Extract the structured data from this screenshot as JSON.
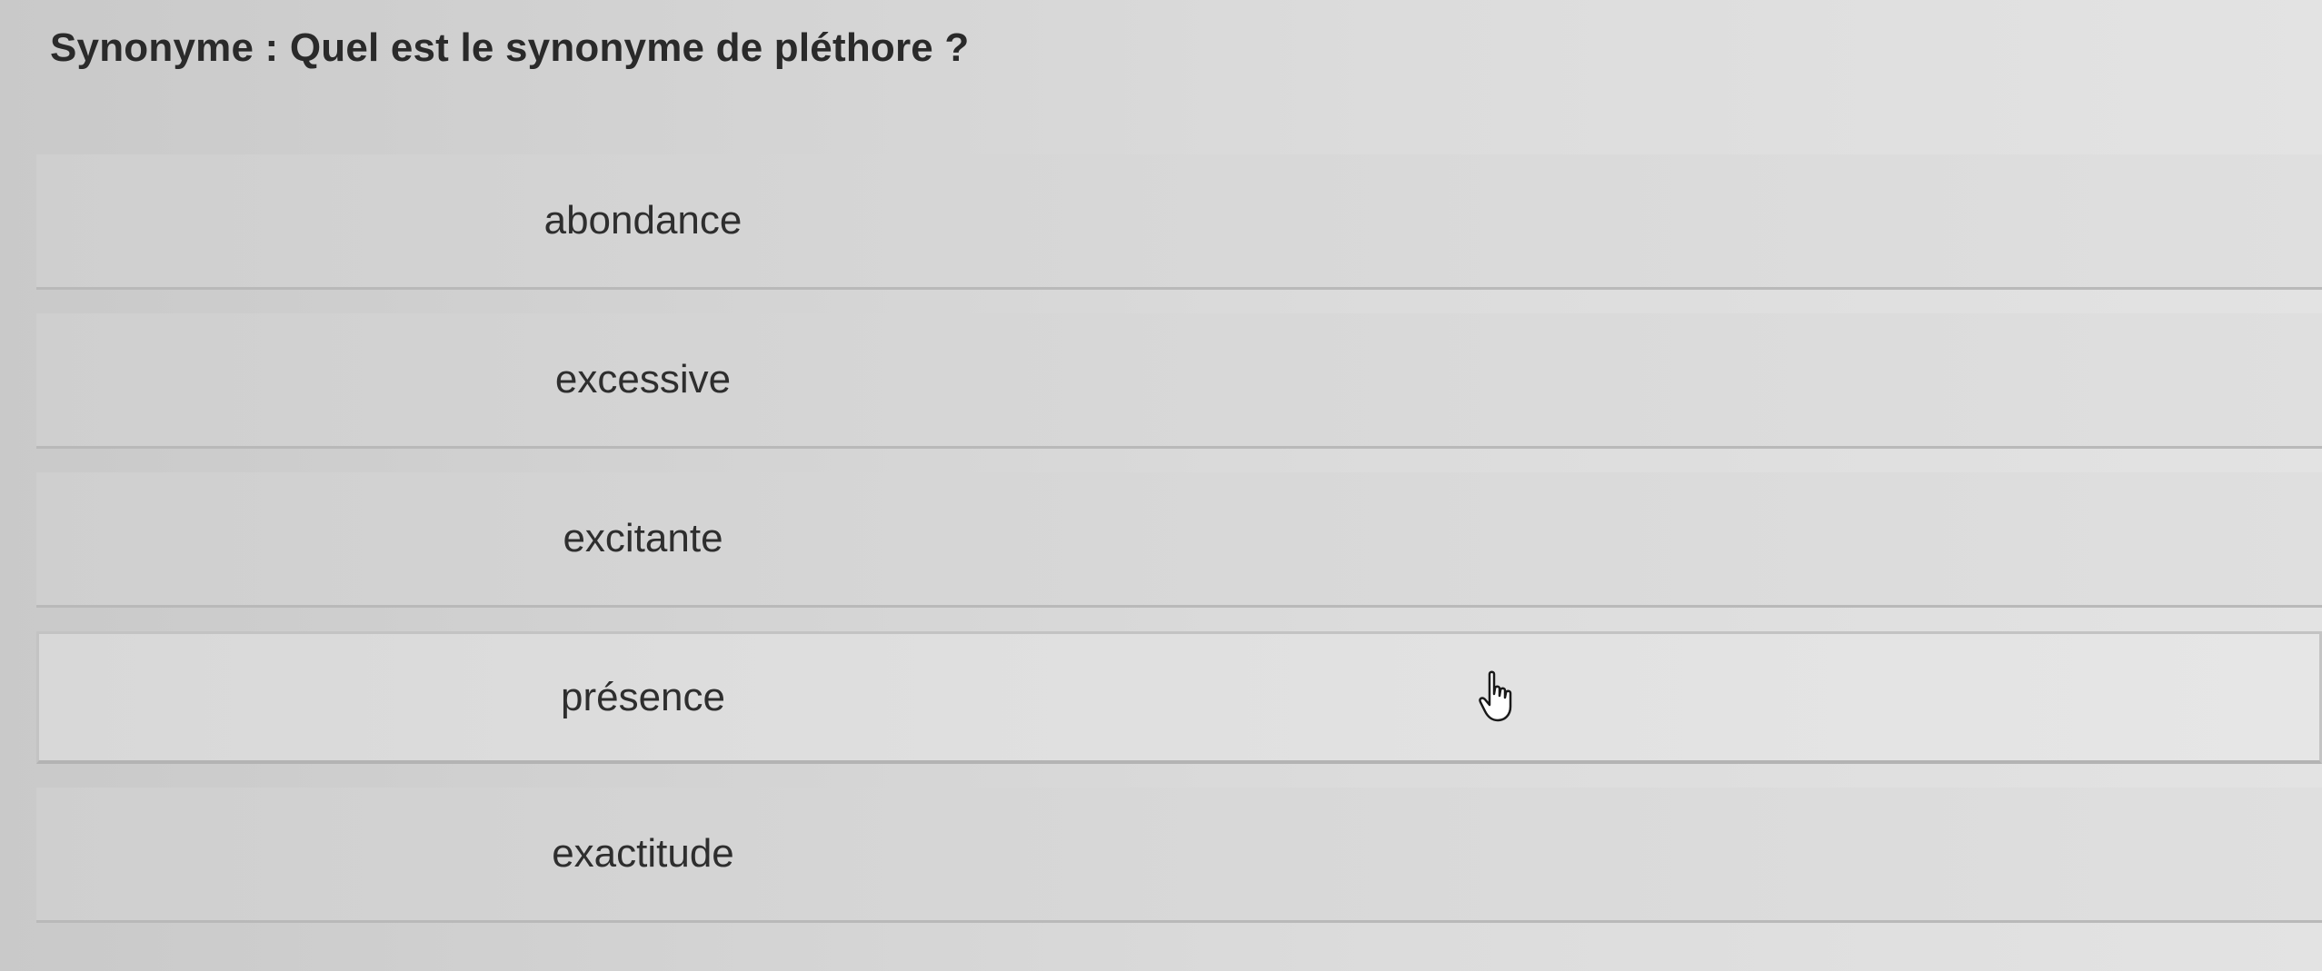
{
  "question": "Synonyme : Quel est le synonyme de pléthore ?",
  "options": [
    {
      "label": "abondance"
    },
    {
      "label": "excessive"
    },
    {
      "label": "excitante"
    },
    {
      "label": "présence"
    },
    {
      "label": "exactitude"
    }
  ],
  "cursor_icon": "hand-pointer-icon"
}
